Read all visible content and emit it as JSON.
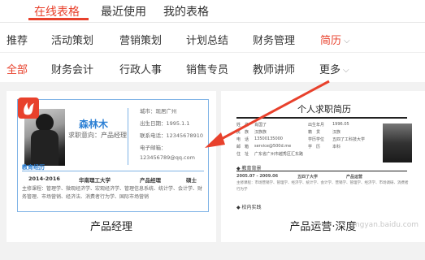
{
  "top_tabs": [
    {
      "label": "在线表格",
      "active": true
    },
    {
      "label": "最近使用",
      "active": false
    },
    {
      "label": "我的表格",
      "active": false
    }
  ],
  "categories": [
    {
      "label": "推荐"
    },
    {
      "label": "活动策划"
    },
    {
      "label": "营销策划"
    },
    {
      "label": "计划总结"
    },
    {
      "label": "财务管理"
    },
    {
      "label": "简历",
      "active": true
    }
  ],
  "subcategories": [
    {
      "label": "全部",
      "active": true
    },
    {
      "label": "财务会计"
    },
    {
      "label": "行政人事"
    },
    {
      "label": "销售专员"
    },
    {
      "label": "教师讲师"
    },
    {
      "label": "更多"
    }
  ],
  "cards": [
    {
      "title": "产品经理",
      "resume": {
        "name": "森林木",
        "intent": "求职意向：产品经理",
        "info": [
          "城市：现居广州",
          "出生日期：1995.1.1",
          "联系电话：12345678910",
          "电子邮箱：",
          "123456789@qq.com"
        ],
        "section": "教育经历",
        "edu": [
          "2014-2016",
          "华南理工大学",
          "产品经理",
          "硕士"
        ],
        "courses": "主修课程：管理学、微观经济学、宏观经济学、管理信息系统、统计学、会计学、财务管理、市场营销、经济法、消费者行为学、国际市场营销"
      }
    },
    {
      "title": "产品运营·深度",
      "resume": {
        "heading": "个人求职简历",
        "info_rows": [
          [
            "姓　名",
            "肖国了",
            "出生年月",
            "1996.05"
          ],
          [
            "民　族",
            "汉族族",
            "籍　贯",
            "汉族"
          ],
          [
            "电　话",
            "13500135000",
            "学历学位",
            "五四了工科技大学"
          ],
          [
            "邮　箱",
            "service@500d.me",
            "学　历",
            "本科"
          ],
          [
            "住　址",
            "广东省广州市越秀区汇东路",
            "",
            ""
          ]
        ],
        "section1": "教育背景",
        "edu": [
          "2005.07 - 2009.06",
          "五四了大学",
          "产品运营"
        ],
        "section2": "校内实践",
        "courses": "主修课程：市场营销学、管理学、经济学、统计学、会计学、营销学、管理学、经济学、市场调研、消费者行为学",
        "watermark": "jingyan.baidu.com"
      }
    }
  ],
  "accent_color": "#e8412c"
}
